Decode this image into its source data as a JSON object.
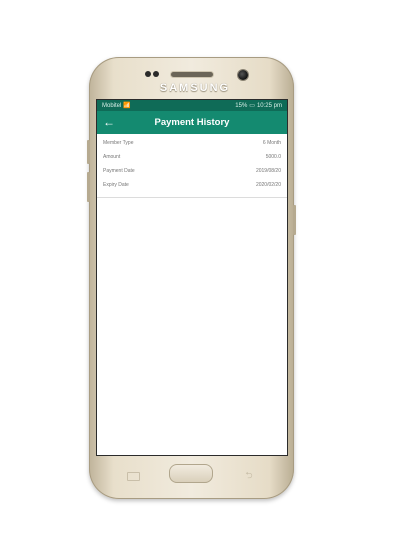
{
  "device": {
    "brand": "SAMSUNG"
  },
  "status_bar": {
    "carrier": "Mobitel",
    "signal": "📶",
    "battery": "15%",
    "time": "10:25 pm"
  },
  "app_bar": {
    "back_icon": "←",
    "title": "Payment History"
  },
  "payment": {
    "rows": [
      {
        "label": "Member Type",
        "value": "6 Month"
      },
      {
        "label": "Amount",
        "value": "5000.0"
      },
      {
        "label": "Payment Date",
        "value": "2019/08/20"
      },
      {
        "label": "Expiry Date",
        "value": "2020/02/20"
      }
    ]
  },
  "colors": {
    "status_bar": "#0f6b57",
    "app_bar": "#148a70"
  },
  "nav": {
    "back_icon": "⮌"
  }
}
